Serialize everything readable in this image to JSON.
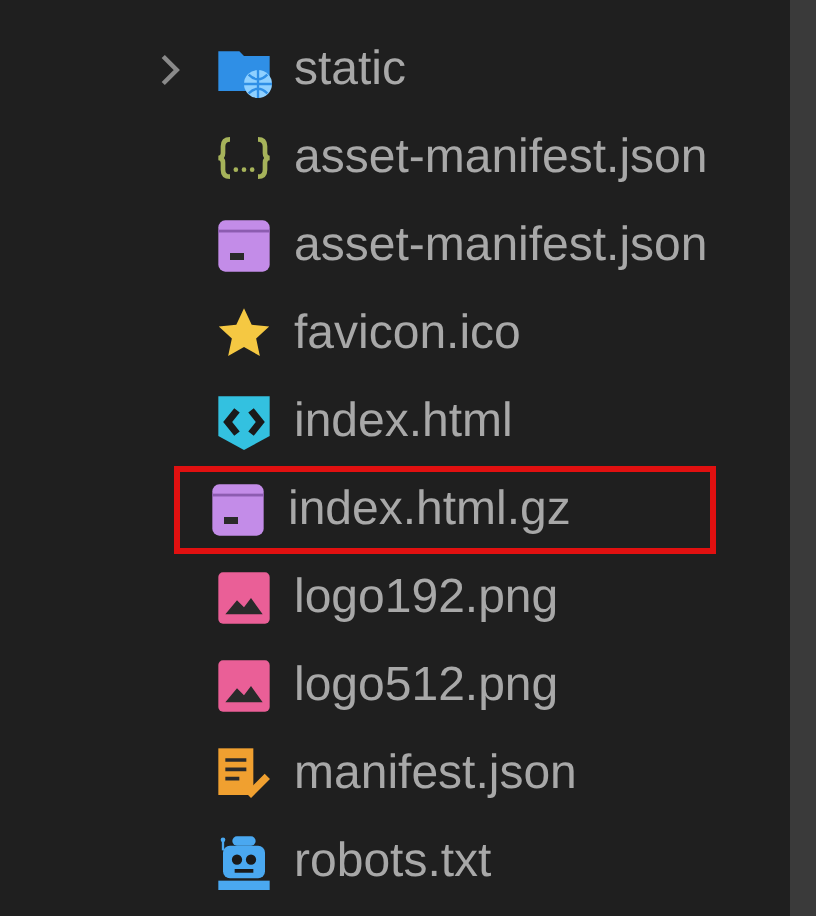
{
  "tree": [
    {
      "kind": "folder",
      "label": "static",
      "expanded": false,
      "highlighted": false
    },
    {
      "kind": "json",
      "label": "asset-manifest.json",
      "highlighted": false
    },
    {
      "kind": "archive",
      "label": "asset-manifest.json",
      "highlighted": false
    },
    {
      "kind": "star",
      "label": "favicon.ico",
      "highlighted": false
    },
    {
      "kind": "html",
      "label": "index.html",
      "highlighted": false
    },
    {
      "kind": "archive",
      "label": "index.html.gz",
      "highlighted": true
    },
    {
      "kind": "image",
      "label": "logo192.png",
      "highlighted": false
    },
    {
      "kind": "image",
      "label": "logo512.png",
      "highlighted": false
    },
    {
      "kind": "manifest",
      "label": "manifest.json",
      "highlighted": false
    },
    {
      "kind": "robot",
      "label": "robots.txt",
      "highlighted": false
    }
  ]
}
